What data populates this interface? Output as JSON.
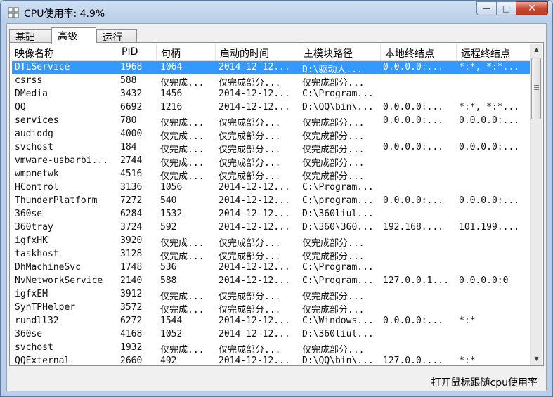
{
  "window": {
    "title": "CPU使用率: 4.9%",
    "minimize_glyph": "—",
    "maximize_glyph": "□",
    "close_glyph": "✕"
  },
  "tabs": [
    {
      "label": "基础",
      "active": false
    },
    {
      "label": "高级",
      "active": true
    },
    {
      "label": "运行",
      "active": false
    }
  ],
  "columns": [
    "映像名称",
    "PID",
    "句柄",
    "启动的时间",
    "主模块路径",
    "本地终结点",
    "远程终结点"
  ],
  "rows": [
    [
      "DTLService",
      "1968",
      "1064",
      "2014-12-12...",
      "D:\\驱动人...",
      "0.0.0.0:...",
      "*:*, *:*..."
    ],
    [
      "csrss",
      "588",
      "仅完成...",
      "仅完成部分...",
      "仅完成部分...",
      "",
      ""
    ],
    [
      "DMedia",
      "3432",
      "1456",
      "2014-12-12...",
      "C:\\Program...",
      "",
      ""
    ],
    [
      "QQ",
      "6692",
      "1216",
      "2014-12-12...",
      "D:\\QQ\\bin\\...",
      "0.0.0.0:...",
      "*:*, *:*..."
    ],
    [
      "services",
      "780",
      "仅完成...",
      "仅完成部分...",
      "仅完成部分...",
      "0.0.0.0:...",
      "0.0.0.0:..."
    ],
    [
      "audiodg",
      "4000",
      "仅完成...",
      "仅完成部分...",
      "仅完成部分...",
      "",
      ""
    ],
    [
      "svchost",
      "184",
      "仅完成...",
      "仅完成部分...",
      "仅完成部分...",
      "0.0.0.0:...",
      "0.0.0.0:..."
    ],
    [
      "vmware-usbarbi...",
      "2744",
      "仅完成...",
      "仅完成部分...",
      "仅完成部分...",
      "",
      ""
    ],
    [
      "wmpnetwk",
      "4516",
      "仅完成...",
      "仅完成部分...",
      "仅完成部分...",
      "",
      ""
    ],
    [
      "HControl",
      "3136",
      "1056",
      "2014-12-12...",
      "C:\\Program...",
      "",
      ""
    ],
    [
      "ThunderPlatform",
      "7272",
      "540",
      "2014-12-12...",
      "C:\\program...",
      "0.0.0.0:...",
      "0.0.0.0:..."
    ],
    [
      "360se",
      "6284",
      "1532",
      "2014-12-12...",
      "D:\\360liul...",
      "",
      ""
    ],
    [
      "360tray",
      "3724",
      "592",
      "2014-12-12...",
      "D:\\360\\360...",
      "192.168....",
      "101.199...."
    ],
    [
      "igfxHK",
      "3920",
      "仅完成...",
      "仅完成部分...",
      "仅完成部分...",
      "",
      ""
    ],
    [
      "taskhost",
      "3128",
      "仅完成...",
      "仅完成部分...",
      "仅完成部分...",
      "",
      ""
    ],
    [
      "DhMachineSvc",
      "1748",
      "536",
      "2014-12-12...",
      "C:\\Program...",
      "",
      ""
    ],
    [
      "NvNetworkService",
      "2140",
      "588",
      "2014-12-12...",
      "C:\\Program...",
      "127.0.0.1...",
      "0.0.0.0:0"
    ],
    [
      "igfxEM",
      "3912",
      "仅完成...",
      "仅完成部分...",
      "仅完成部分...",
      "",
      ""
    ],
    [
      "SynTPHelper",
      "3572",
      "仅完成...",
      "仅完成部分...",
      "仅完成部分...",
      "",
      ""
    ],
    [
      "rundll32",
      "6272",
      "1544",
      "2014-12-12...",
      "C:\\Windows...",
      "0.0.0.0:...",
      "*:*"
    ],
    [
      "360se",
      "4168",
      "1052",
      "2014-12-12...",
      "D:\\360liul...",
      "",
      ""
    ],
    [
      "svchost",
      "1932",
      "仅完成...",
      "仅完成部分...",
      "仅完成部分...",
      "",
      ""
    ],
    [
      "QQExternal",
      "2660",
      "492",
      "2014-12-12...",
      "D:\\QQ\\bin\\...",
      "127.0.0....",
      "*:*"
    ]
  ],
  "selected_row": 0,
  "status_label": "打开鼠标跟随cpu使用率",
  "scroll_up_glyph": "▲",
  "scroll_down_glyph": "▼",
  "colors": {
    "selection": "#3399ff",
    "titlebar": "#b9cfe9"
  }
}
